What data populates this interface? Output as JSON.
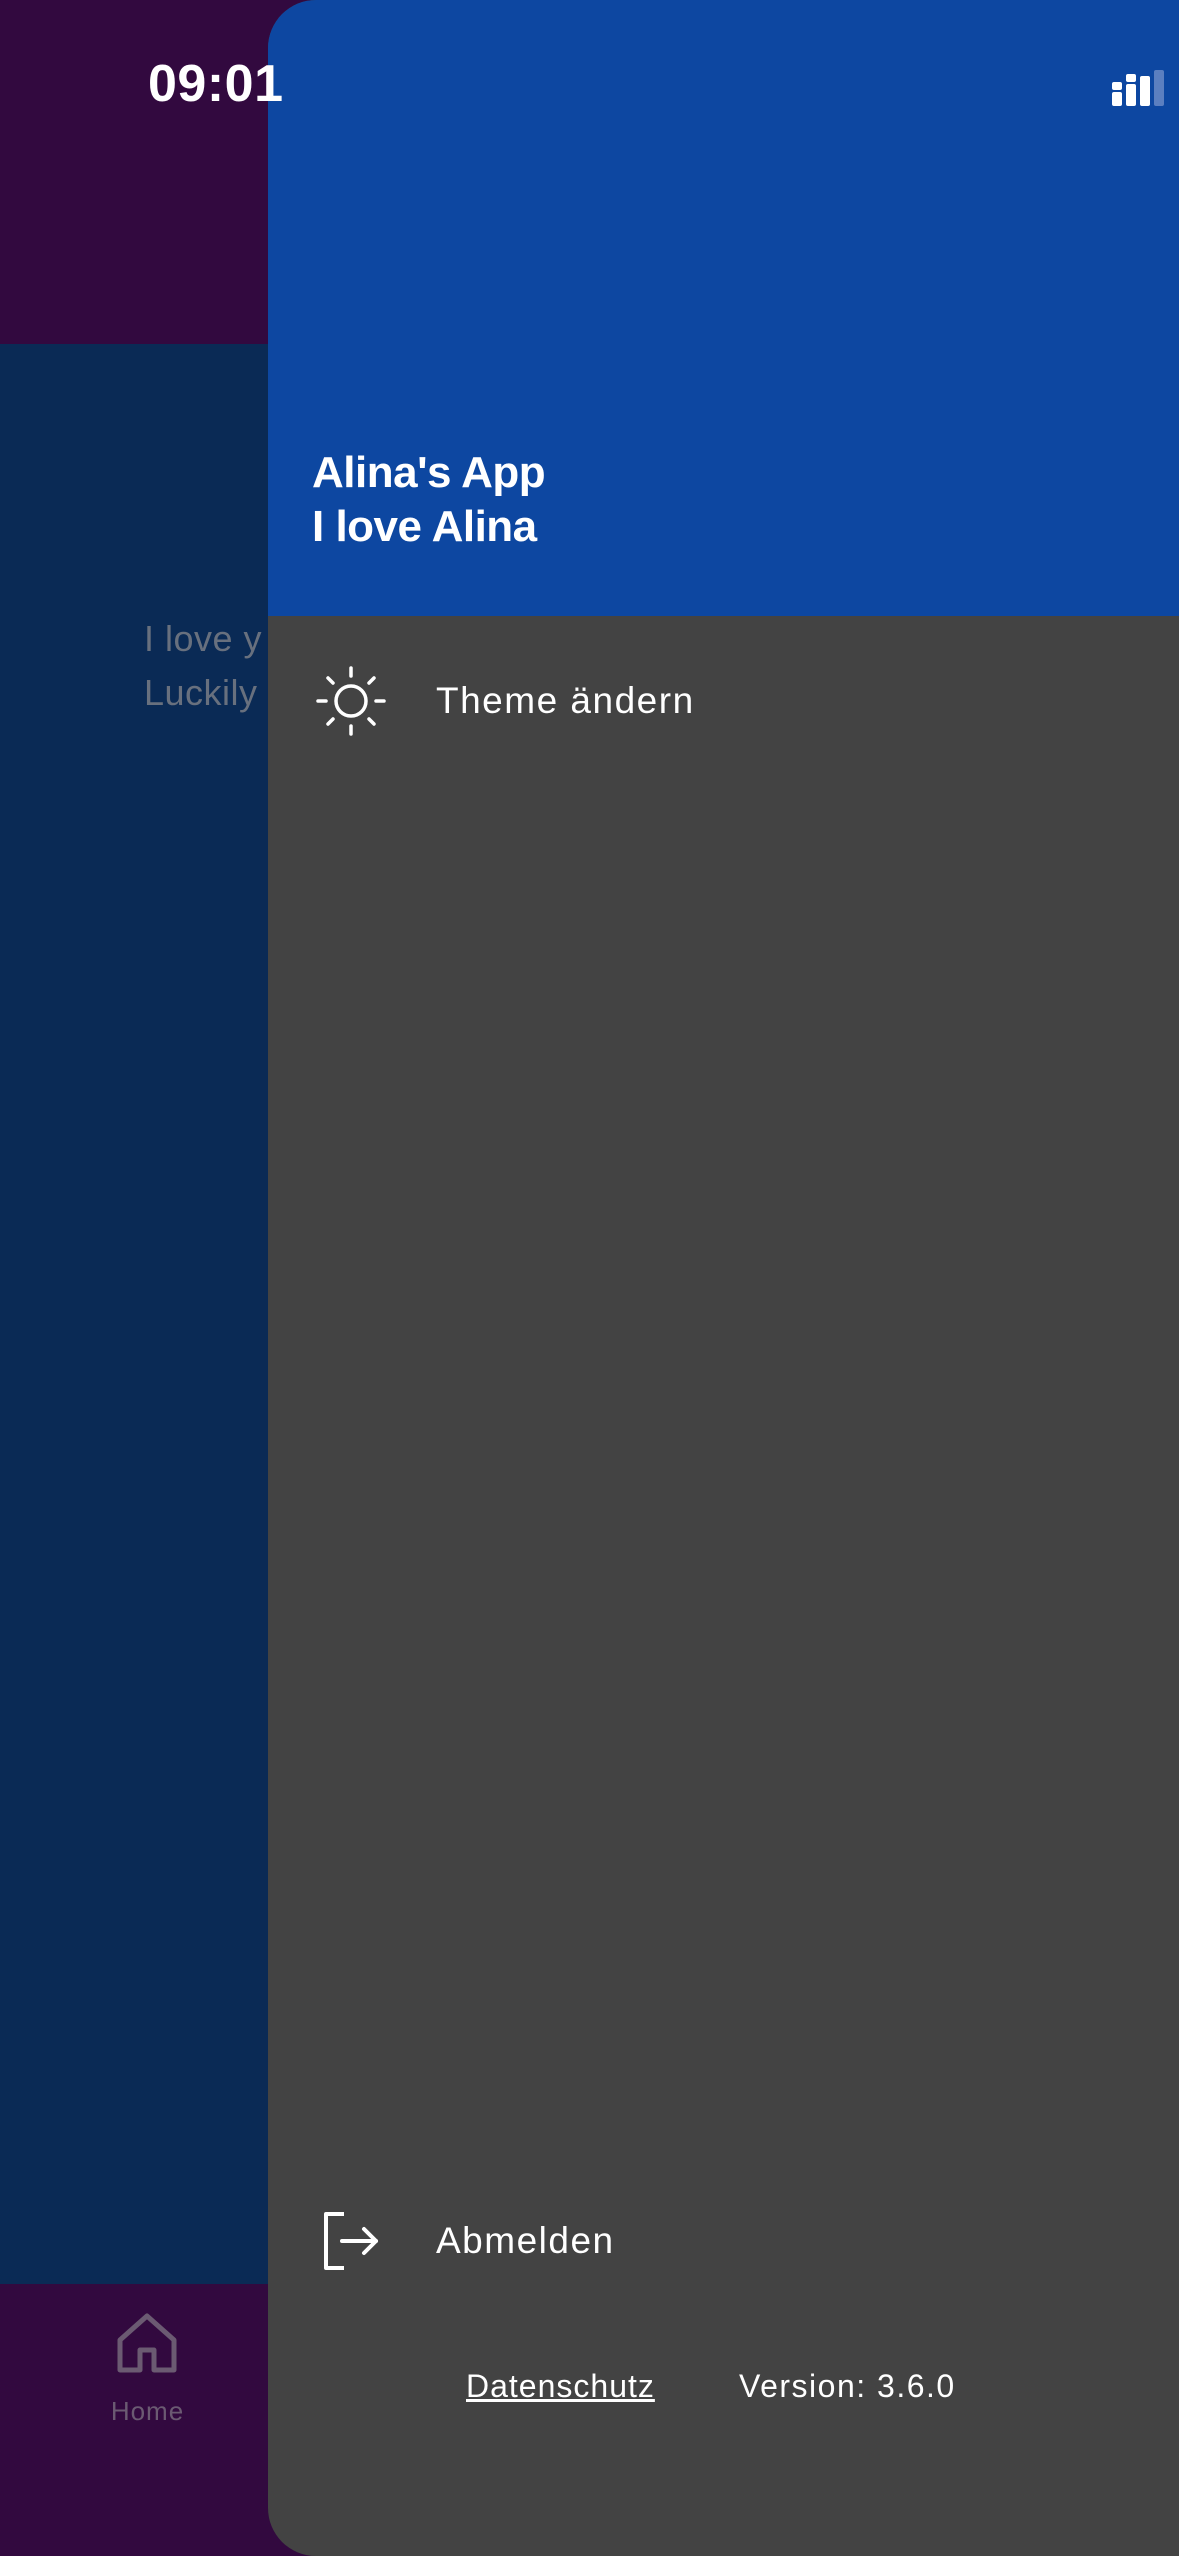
{
  "status_bar": {
    "time": "09:01",
    "battery_level": "95"
  },
  "background_screen": {
    "content_lines": [
      "I love y",
      "Luckily"
    ],
    "bottom_nav": {
      "home_label": "Home"
    }
  },
  "drawer": {
    "header": {
      "app_name": "Alina's App",
      "subtitle": "I love Alina"
    },
    "menu_items": [
      {
        "label": "Theme ändern",
        "icon": "sun-icon"
      }
    ],
    "logout": {
      "label": "Abmelden",
      "icon": "logout-icon"
    },
    "footer": {
      "privacy_link": "Datenschutz",
      "version": "Version: 3.6.0"
    }
  },
  "colors": {
    "drawer_background": "#434343",
    "drawer_header": "#0d47a1",
    "app_bar": "#32093f",
    "content_background": "#0a2a55"
  }
}
